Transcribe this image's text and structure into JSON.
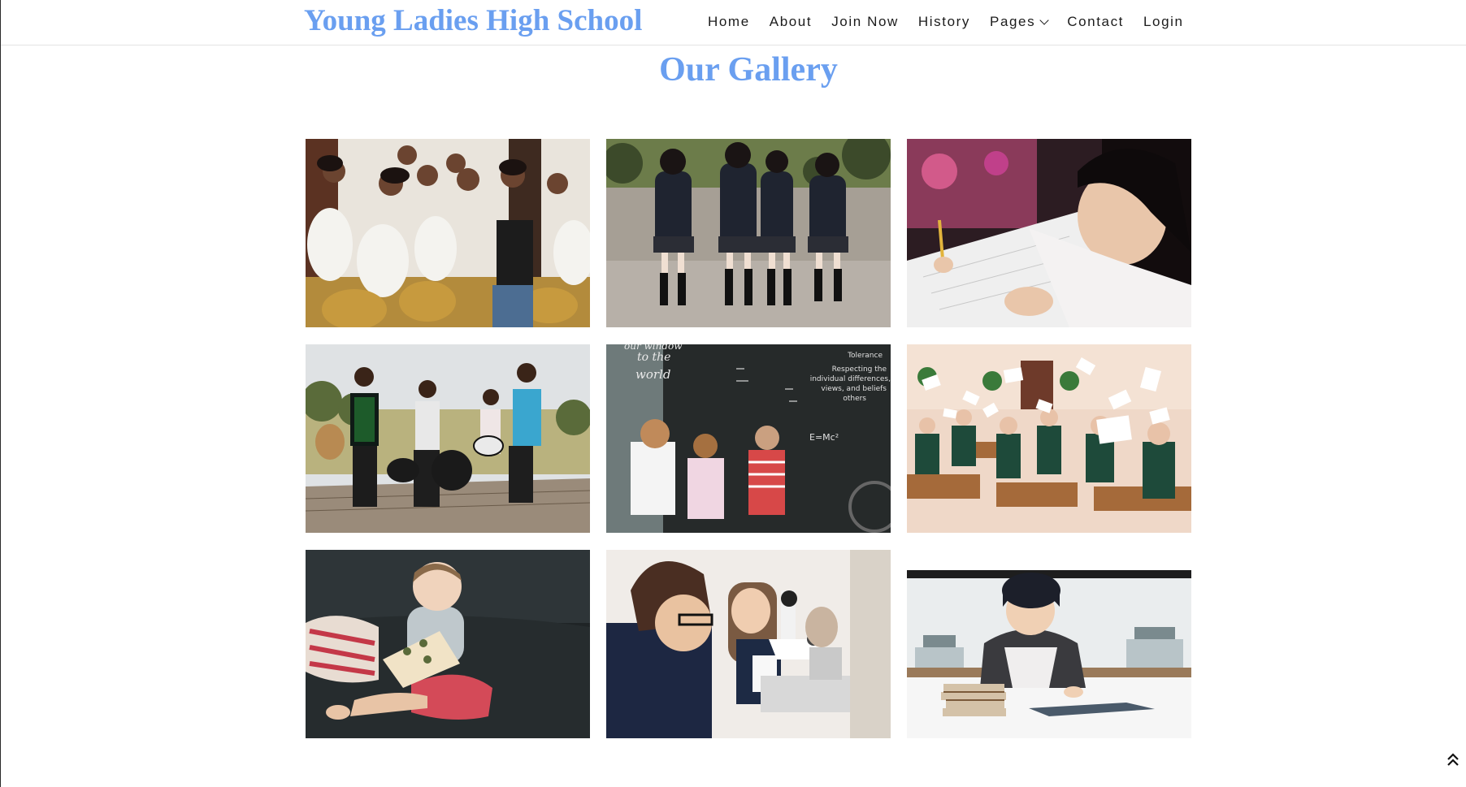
{
  "site": {
    "brand": "Young Ladies High School"
  },
  "nav": {
    "items": [
      {
        "label": "Home"
      },
      {
        "label": "About"
      },
      {
        "label": "Join Now"
      },
      {
        "label": "History"
      },
      {
        "label": "Pages",
        "has_dropdown": true
      },
      {
        "label": "Contact"
      },
      {
        "label": "Login"
      }
    ]
  },
  "gallery": {
    "title": "Our Gallery",
    "images": [
      {
        "subject": "students-laughing"
      },
      {
        "subject": "girls-in-uniform-walking"
      },
      {
        "subject": "girl-writing"
      },
      {
        "subject": "band-playing"
      },
      {
        "subject": "children-at-chalkboard"
      },
      {
        "subject": "classroom-throwing-papers"
      },
      {
        "subject": "toddler-reading-on-sofa"
      },
      {
        "subject": "girls-with-microscope"
      },
      {
        "subject": "boy-with-books"
      }
    ]
  },
  "chalkboard": {
    "left_text": [
      "our window",
      "to the",
      "world"
    ],
    "right_text": [
      "Tolerance",
      "Respecting the",
      "individual differences,",
      "views, and beliefs",
      "others"
    ],
    "formula": "E=Mc²"
  },
  "icons": {
    "back_to_top": "double-chevron-up-icon",
    "dropdown": "chevron-down-icon"
  },
  "colors": {
    "brand": "#6a9ff0",
    "nav_text": "#1c1c1c"
  }
}
